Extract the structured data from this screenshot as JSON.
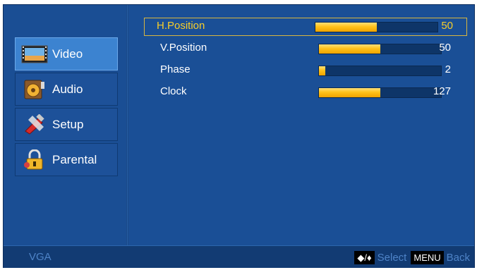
{
  "nav": {
    "items": [
      {
        "label": "Video",
        "icon": "video-icon",
        "active": true
      },
      {
        "label": "Audio",
        "icon": "audio-icon",
        "active": false
      },
      {
        "label": "Setup",
        "icon": "setup-icon",
        "active": false
      },
      {
        "label": "Parental",
        "icon": "lock-icon",
        "active": false
      }
    ]
  },
  "settings": [
    {
      "label": "H.Position",
      "value": "50",
      "level": 0.5,
      "selected": true
    },
    {
      "label": "V.Position",
      "value": "50",
      "level": 0.5,
      "selected": false
    },
    {
      "label": "Phase",
      "value": "2",
      "level": 0.05,
      "selected": false
    },
    {
      "label": "Clock",
      "value": "127",
      "level": 0.5,
      "selected": false
    }
  ],
  "status": {
    "source": "VGA",
    "nav_keys": "◆/♦",
    "select_label": "Select",
    "menu_key": "MENU",
    "back_label": "Back"
  },
  "colors": {
    "background": "#1b4d92",
    "selected_text": "#f6cd2a",
    "bar_fill": "#ffc21a",
    "hint_text": "#4e83c7"
  }
}
